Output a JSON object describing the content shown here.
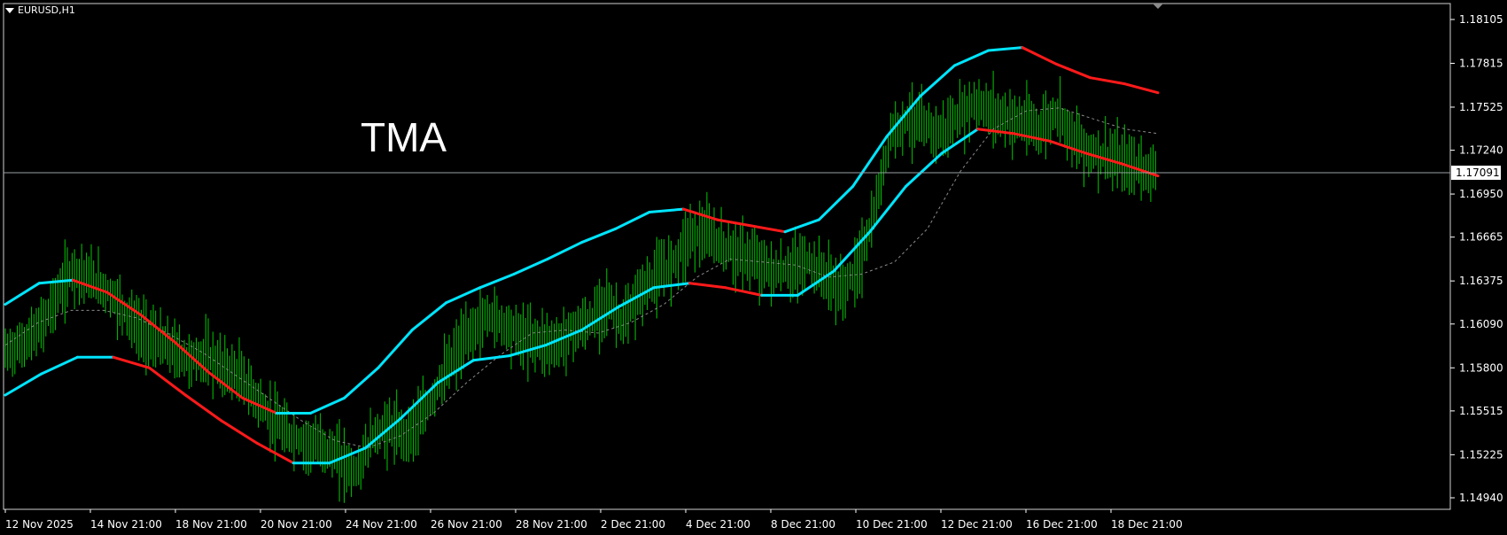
{
  "header": {
    "symbol": "EURUSD,H1"
  },
  "indicator_label": "TMA",
  "colors": {
    "background": "#000000",
    "candles": "#00c800",
    "band_up": "#00e5ff",
    "band_down": "#ff1a1a",
    "mid_line": "#8a8a8a",
    "axis": "#ffffff",
    "current_price_line": "#9aa0a6"
  },
  "chart_data": {
    "type": "line",
    "title": "",
    "y_axis": {
      "ticks": [
        "1.18105",
        "1.17815",
        "1.17525",
        "1.17240",
        "1.16950",
        "1.16665",
        "1.16375",
        "1.16090",
        "1.15800",
        "1.15515",
        "1.15225",
        "1.14940"
      ],
      "ylim": [
        1.1474,
        1.1832
      ]
    },
    "x_axis": {
      "ticks": [
        "12 Nov 2025",
        "14 Nov 21:00",
        "18 Nov 21:00",
        "20 Nov 21:00",
        "24 Nov 21:00",
        "26 Nov 21:00",
        "28 Nov 21:00",
        "2 Dec 21:00",
        "4 Dec 21:00",
        "8 Dec 21:00",
        "10 Dec 21:00",
        "12 Dec 21:00",
        "16 Dec 21:00",
        "18 Dec 21:00"
      ]
    },
    "current_price": "1.17091",
    "series": [
      {
        "role": "price",
        "values": [
          1.159,
          1.1595,
          1.1605,
          1.1625,
          1.1645,
          1.164,
          1.1632,
          1.162,
          1.1605,
          1.1598,
          1.1592,
          1.1585,
          1.1588,
          1.158,
          1.1575,
          1.156,
          1.1545,
          1.1535,
          1.153,
          1.1528,
          1.152,
          1.151,
          1.1535,
          1.154,
          1.1535,
          1.1548,
          1.157,
          1.159,
          1.1605,
          1.1615,
          1.1608,
          1.16,
          1.1598,
          1.1595,
          1.1605,
          1.161,
          1.1625,
          1.1608,
          1.163,
          1.164,
          1.165,
          1.1668,
          1.1668,
          1.166,
          1.1655,
          1.165,
          1.1642,
          1.1645,
          1.165,
          1.1642,
          1.163,
          1.1645,
          1.168,
          1.1735,
          1.1745,
          1.174,
          1.1735,
          1.1745,
          1.1755,
          1.175,
          1.1745,
          1.1742,
          1.1738,
          1.175,
          1.1732,
          1.1722,
          1.172,
          1.1715,
          1.1712,
          1.1709
        ]
      },
      {
        "role": "tma-mid",
        "values": [
          1.1595,
          1.161,
          1.1618,
          1.1618,
          1.1613,
          1.1602,
          1.159,
          1.1575,
          1.156,
          1.1545,
          1.1532,
          1.1527,
          1.1535,
          1.155,
          1.157,
          1.1588,
          1.1603,
          1.1605,
          1.1603,
          1.161,
          1.1622,
          1.164,
          1.1652,
          1.165,
          1.1648,
          1.164,
          1.1642,
          1.165,
          1.1672,
          1.171,
          1.1738,
          1.175,
          1.1752,
          1.1745,
          1.1738,
          1.1735
        ]
      },
      {
        "role": "tma-upper",
        "values": [
          1.1622,
          1.1636,
          1.1638,
          1.163,
          1.1615,
          1.1597,
          1.1577,
          1.156,
          1.155,
          1.155,
          1.156,
          1.158,
          1.1605,
          1.1623,
          1.1633,
          1.1642,
          1.1652,
          1.1663,
          1.1672,
          1.1683,
          1.1685,
          1.1678,
          1.1674,
          1.167,
          1.1678,
          1.17,
          1.1733,
          1.176,
          1.178,
          1.179,
          1.1792,
          1.1781,
          1.1772,
          1.1768,
          1.1762
        ]
      },
      {
        "role": "tma-lower",
        "values": [
          1.1562,
          1.1576,
          1.1587,
          1.1587,
          1.158,
          1.1562,
          1.1545,
          1.153,
          1.1517,
          1.1517,
          1.1527,
          1.1547,
          1.157,
          1.1585,
          1.1588,
          1.1595,
          1.1605,
          1.162,
          1.1633,
          1.1636,
          1.1633,
          1.1628,
          1.1628,
          1.1644,
          1.167,
          1.17,
          1.1722,
          1.1738,
          1.1735,
          1.173,
          1.1722,
          1.1715,
          1.1707
        ]
      }
    ]
  }
}
